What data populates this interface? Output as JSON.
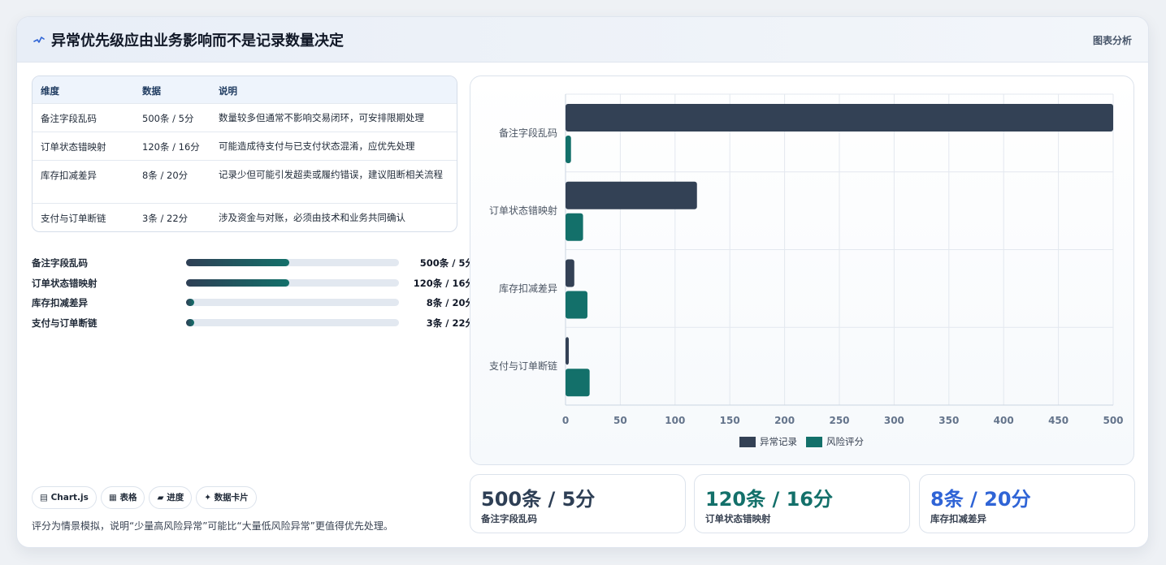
{
  "header": {
    "title": "异常优先级应由业务影响而不是记录数量决定",
    "tag": "图表分析"
  },
  "table": {
    "headers": [
      "维度",
      "数据",
      "说明"
    ],
    "rows": [
      {
        "dim": "备注字段乱码",
        "data": "500条 / 5分",
        "desc": "数量较多但通常不影响交易闭环，可安排限期处理"
      },
      {
        "dim": "订单状态错映射",
        "data": "120条 / 16分",
        "desc": "可能造成待支付与已支付状态混淆，应优先处理"
      },
      {
        "dim": "库存扣减差异",
        "data": "8条 / 20分",
        "desc": "记录少但可能引发超卖或履约错误，建议阻断相关流程"
      },
      {
        "dim": "支付与订单断链",
        "data": "3条 / 22分",
        "desc": "涉及资金与对账，必须由技术和业务共同确认"
      }
    ]
  },
  "progress": [
    {
      "label": "备注字段乱码",
      "value": "500条 / 5分",
      "fraction": 0.485
    },
    {
      "label": "订单状态错映射",
      "value": "120条 / 16分",
      "fraction": 0.485
    },
    {
      "label": "库存扣减差异",
      "value": "8条 / 20分",
      "fraction": 0.04
    },
    {
      "label": "支付与订单断链",
      "value": "3条 / 22分",
      "fraction": 0.04
    }
  ],
  "chips": [
    {
      "icon": "chart-icon",
      "glyph": "▤",
      "label": "Chart.js"
    },
    {
      "icon": "table-icon",
      "glyph": "▦",
      "label": "表格"
    },
    {
      "icon": "progress-icon",
      "glyph": "▰",
      "label": "进度"
    },
    {
      "icon": "sparkle-icon",
      "glyph": "✦",
      "label": "数据卡片"
    }
  ],
  "note": "评分为情景模拟，说明“少量高风险异常”可能比“大量低风险异常”更值得优先处理。",
  "stats": [
    {
      "value": "500条 / 5分",
      "label": "备注字段乱码",
      "color": "#2e3f55"
    },
    {
      "value": "120条 / 16分",
      "label": "订单状态错映射",
      "color": "#13706a"
    },
    {
      "value": "8条 / 20分",
      "label": "库存扣减差异",
      "color": "#2f64d6"
    }
  ],
  "colors": {
    "records": "#334155",
    "risk": "#13706a",
    "accent": "#2f64d6"
  },
  "chart_data": {
    "type": "bar",
    "orientation": "horizontal",
    "categories": [
      "备注字段乱码",
      "订单状态错映射",
      "库存扣减差异",
      "支付与订单断链"
    ],
    "series": [
      {
        "name": "异常记录",
        "values": [
          500,
          120,
          8,
          3
        ],
        "color": "#334155"
      },
      {
        "name": "风险评分",
        "values": [
          5,
          16,
          20,
          22
        ],
        "color": "#13706a"
      }
    ],
    "xlim": [
      0,
      500
    ],
    "xticks": [
      0,
      50,
      100,
      150,
      200,
      250,
      300,
      350,
      400,
      450,
      500
    ],
    "grid": true,
    "legend": "bottom"
  }
}
